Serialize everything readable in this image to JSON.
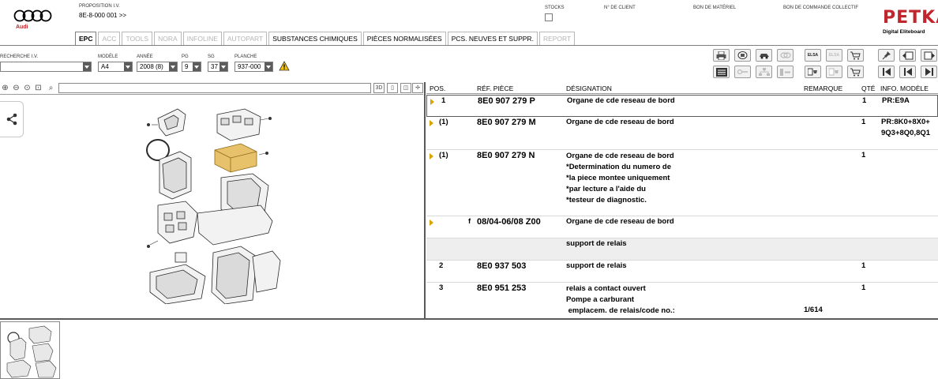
{
  "header": {
    "brand": "Audi",
    "proposition_label": "PROPOSITION I.V.",
    "proposition_value": "8E-8-000 001 >>",
    "stocks_label": "STOCKS",
    "client_label": "N° DE CLIENT",
    "material_label": "BON DE MATÉRIEL",
    "order_label": "BON DE COMMANDE COLLECTIF",
    "petka_title": "PETKA",
    "petka_subtitle": "Digital Eliteboard"
  },
  "tabs": [
    {
      "label": "EPC",
      "state": "active"
    },
    {
      "label": "ACC",
      "state": "disabled"
    },
    {
      "label": "TOOLS",
      "state": "disabled"
    },
    {
      "label": "NORA",
      "state": "disabled"
    },
    {
      "label": "INFOLINE",
      "state": "disabled"
    },
    {
      "label": "AUTOPART",
      "state": "disabled"
    },
    {
      "label": "SUBSTANCES CHIMIQUES",
      "state": "enabled"
    },
    {
      "label": "PIÈCES NORMALISÉES",
      "state": "enabled"
    },
    {
      "label": "PCS. NEUVES ET SUPPR.",
      "state": "enabled"
    },
    {
      "label": "REPORT",
      "state": "disabled"
    }
  ],
  "filters": {
    "search_label": "RECHERCHE I.V.",
    "model_label": "MODÈLE",
    "model_value": "A4",
    "year_label": "ANNÉE",
    "year_value": "2008 (8)",
    "pg_label": "PG",
    "pg_value": "9",
    "sg_label": "SG",
    "sg_value": "37",
    "board_label": "PLANCHE",
    "board_value": "937-000"
  },
  "toolbar": {
    "elsa_label": "ELSA",
    "elsa_label2": "ELSA",
    "view_3d": "3D"
  },
  "table": {
    "headers": {
      "pos": "POS.",
      "ref": "RÉF. PIÈCE",
      "designation": "DÉSIGNATION",
      "remark": "REMARQUE",
      "qty": "QTÉ",
      "model_info": "INFO. MODÈLE"
    },
    "rows": [
      {
        "pos": "1",
        "ref": "8E0 907 279 P",
        "des": [
          "Organe de cde reseau de bord"
        ],
        "remark": "",
        "qty": "1",
        "info": [
          "PR:E9A"
        ]
      },
      {
        "pos": "(1)",
        "ref": "8E0 907 279 M",
        "des": [
          "Organe de cde reseau de bord"
        ],
        "remark": "",
        "qty": "1",
        "info": [
          "PR:8K0+8X0+",
          "9Q3+8Q0,8Q1"
        ]
      },
      {
        "pos": "(1)",
        "ref": "8E0 907 279 N",
        "des": [
          "Organe de cde reseau de bord",
          "*Determination du numero de",
          "*la piece montee uniquement",
          "*par lecture a l'aide du",
          "*testeur de diagnostic."
        ],
        "remark": "",
        "qty": "1",
        "info": []
      },
      {
        "pos": "f",
        "ref": "08/04-06/08 Z00",
        "des": [
          "Organe de cde reseau de bord"
        ],
        "remark": "",
        "qty": "",
        "info": []
      },
      {
        "pos": "",
        "ref": "",
        "des": [
          "support de relais"
        ],
        "remark": "",
        "qty": "",
        "info": []
      },
      {
        "pos": "2",
        "ref": "8E0 937 503",
        "des": [
          "support de relais"
        ],
        "remark": "",
        "qty": "1",
        "info": []
      },
      {
        "pos": "3",
        "ref": "8E0 951 253",
        "des": [
          "relais a contact ouvert",
          "Pompe a carburant",
          " emplacem. de relais/code no.:"
        ],
        "remark": "1/614",
        "qty": "1",
        "info": []
      }
    ]
  }
}
